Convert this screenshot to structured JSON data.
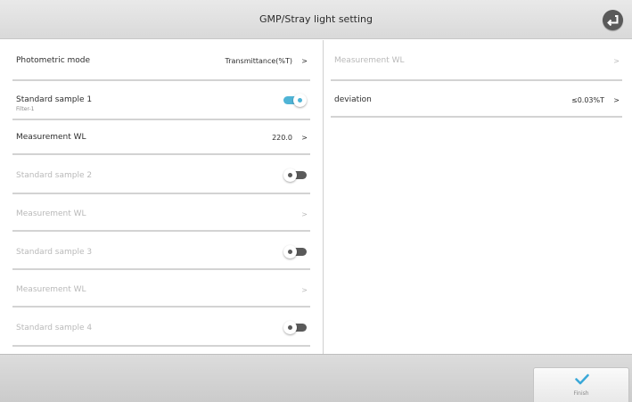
{
  "header": {
    "title": "GMP/Stray light setting",
    "back_icon": "back-arrow-icon"
  },
  "left": {
    "photometric_mode": {
      "label": "Photometric mode",
      "value": "Transmittance(%T)",
      "arrow": ">"
    },
    "standard_sample_1": {
      "label": "Standard sample 1",
      "sub": "Filter-1",
      "toggle": "on"
    },
    "measurement_wl_1": {
      "label": "Measurement WL",
      "value": "220.0",
      "arrow": ">"
    },
    "standard_sample_2": {
      "label": "Standard sample 2",
      "toggle": "off"
    },
    "measurement_wl_2": {
      "label": "Measurement WL",
      "arrow": ">"
    },
    "standard_sample_3": {
      "label": "Standard sample 3",
      "toggle": "off"
    },
    "measurement_wl_3": {
      "label": "Measurement WL",
      "arrow": ">"
    },
    "standard_sample_4": {
      "label": "Standard sample 4",
      "toggle": "off"
    }
  },
  "right": {
    "measurement_wl": {
      "label": "Measurement WL",
      "arrow": ">"
    },
    "deviation": {
      "label": "deviation",
      "value": "≤0.03%T",
      "arrow": ">"
    }
  },
  "footer": {
    "finish_label": "Finish",
    "finish_icon": "check-icon"
  },
  "colors": {
    "accent": "#4fb4d6",
    "toggle_off": "#5a5a5a",
    "disabled_text": "#b9b9b9",
    "text": "#2e2e2e"
  }
}
